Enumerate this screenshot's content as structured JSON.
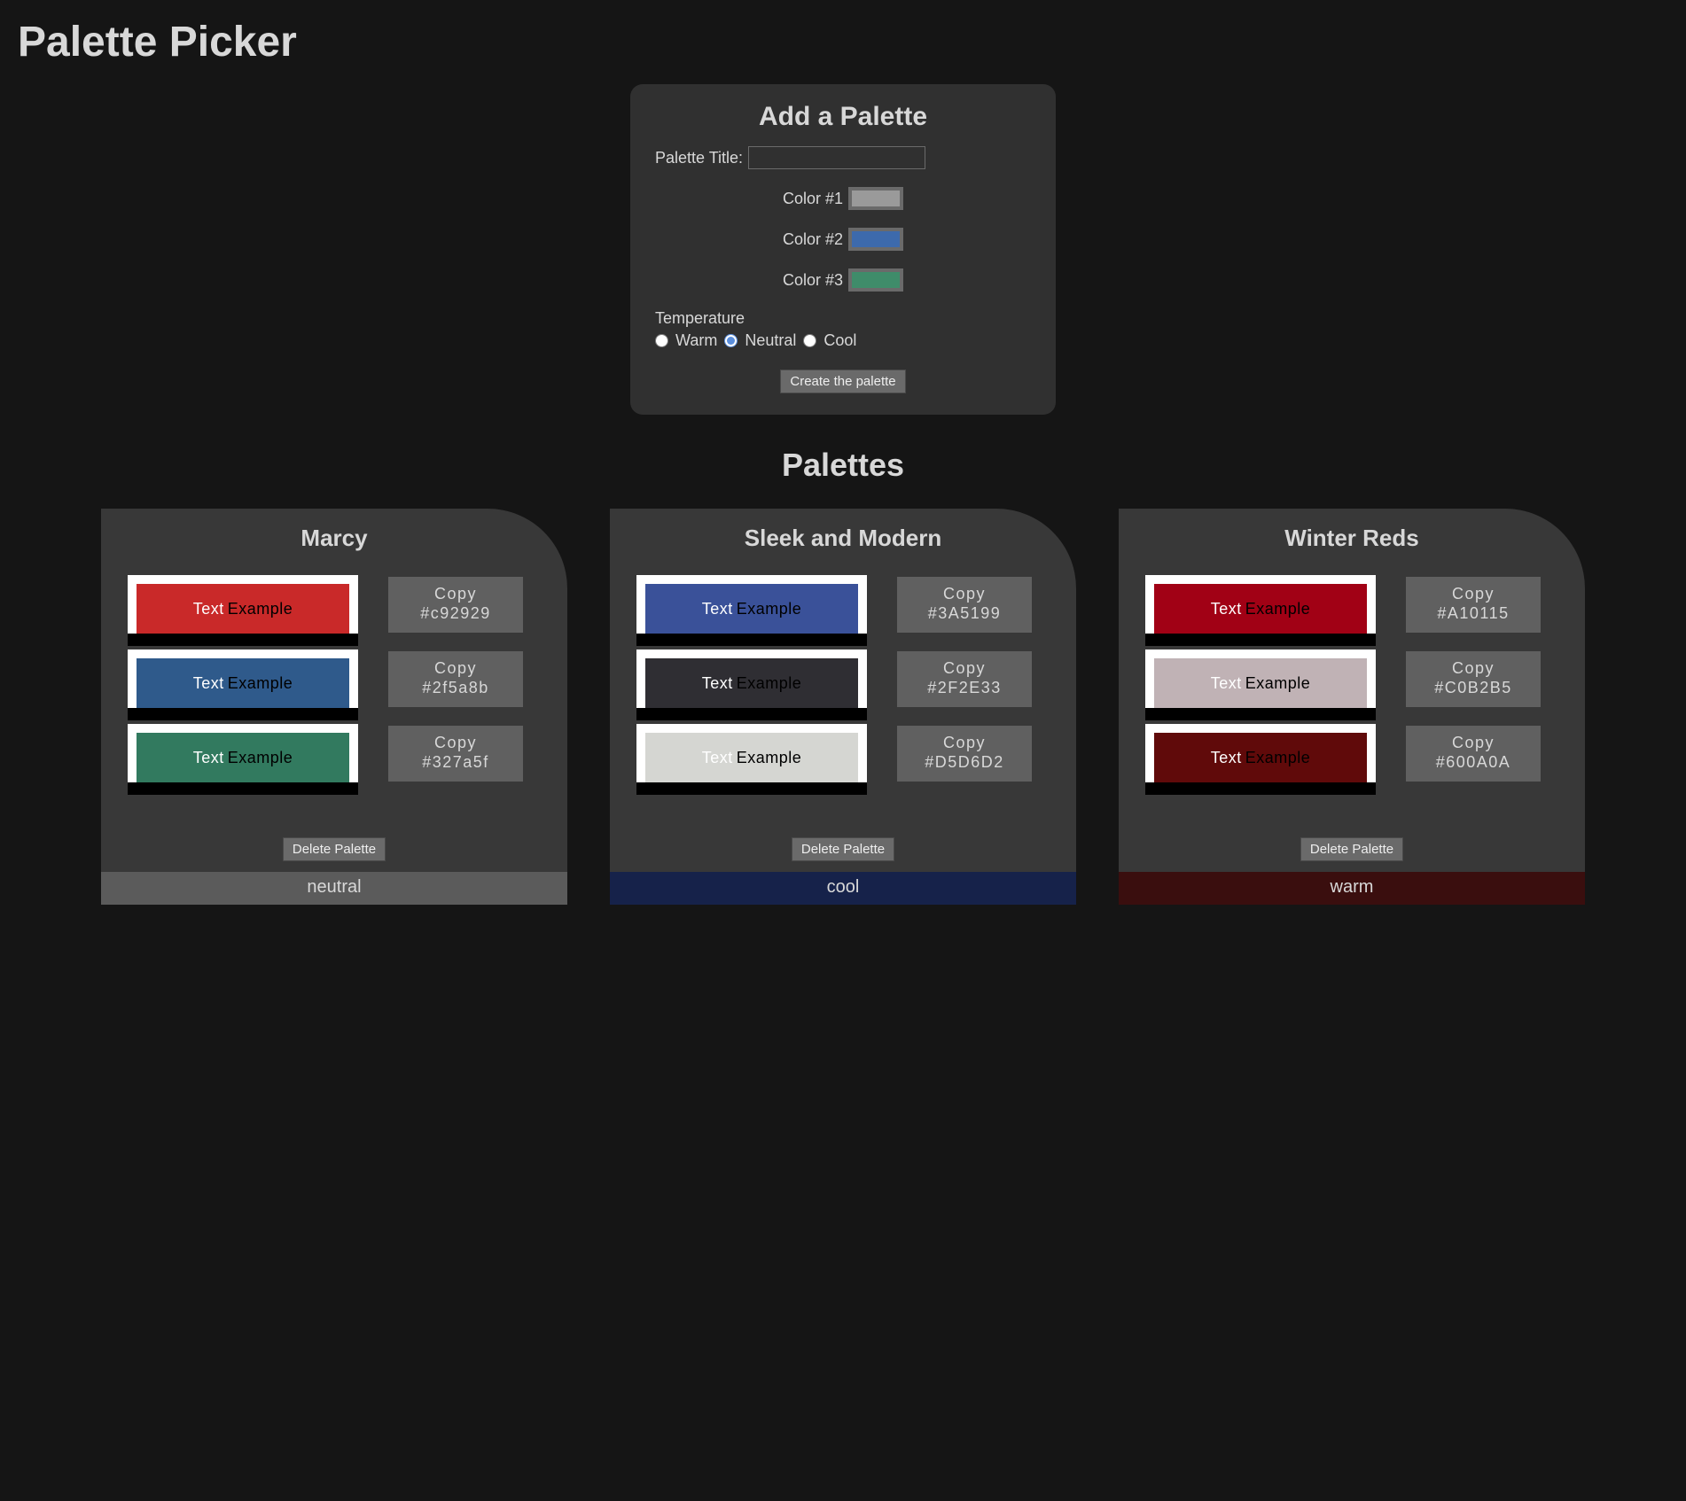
{
  "header": {
    "title": "Palette Picker"
  },
  "form": {
    "title": "Add a Palette",
    "title_field_label": "Palette Title:",
    "title_value": "",
    "colors": [
      {
        "label": "Color #1",
        "value": "#9a9a9a"
      },
      {
        "label": "Color #2",
        "value": "#3d6aac"
      },
      {
        "label": "Color #3",
        "value": "#3f8c6a"
      }
    ],
    "temperature_label": "Temperature",
    "temperature_options": [
      "Warm",
      "Neutral",
      "Cool"
    ],
    "temperature_selected": "Neutral",
    "submit_label": "Create the palette"
  },
  "palettes_heading": "Palettes",
  "copy_word": "Copy",
  "sample_text_a": "Text",
  "sample_text_b": "Example",
  "delete_label": "Delete Palette",
  "temperature_colors": {
    "neutral": "#5b5b5b",
    "cool": "#16224a",
    "warm": "#3a0e0e"
  },
  "palettes": [
    {
      "name": "Marcy",
      "temperature": "neutral",
      "colors": [
        "#c92929",
        "#2f5a8b",
        "#327a5f"
      ]
    },
    {
      "name": "Sleek and Modern",
      "temperature": "cool",
      "colors": [
        "#3A5199",
        "#2F2E33",
        "#D5D6D2"
      ]
    },
    {
      "name": "Winter Reds",
      "temperature": "warm",
      "colors": [
        "#A10115",
        "#C0B2B5",
        "#600A0A"
      ]
    }
  ]
}
